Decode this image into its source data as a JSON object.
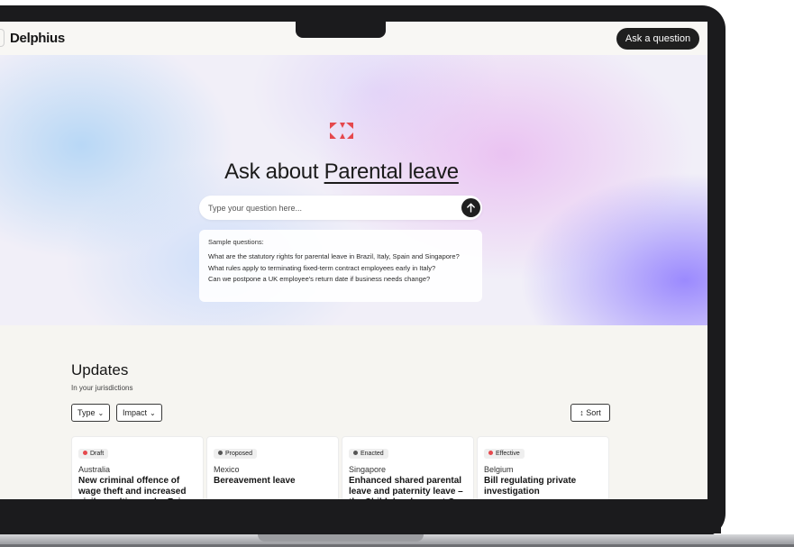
{
  "topbar": {
    "brand": "Delphius",
    "ask_button": "Ask a question"
  },
  "hero": {
    "title_prefix": "Ask about",
    "title_topic": "Parental leave",
    "search_placeholder": "Type your question here...",
    "samples_heading": "Sample questions:",
    "sample_questions": [
      "What are the statutory rights for parental leave in Brazil, Italy, Spain and Singapore?",
      "What rules apply to terminating fixed-term contract employees early in Italy?",
      "Can we postpone a UK employee's return date if business needs change?"
    ]
  },
  "updates": {
    "title": "Updates",
    "subtitle": "In your jurisdictions",
    "filters": [
      "Type",
      "Impact"
    ],
    "sort_label": "Sort",
    "cards": [
      {
        "status": "Draft",
        "status_color": "#e5484d",
        "country": "Australia",
        "title": "New criminal offence of wage theft and increased civil penalties under Fair"
      },
      {
        "status": "Proposed",
        "status_color": "#555555",
        "country": "Mexico",
        "title": "Bereavement leave"
      },
      {
        "status": "Enacted",
        "status_color": "#555555",
        "country": "Singapore",
        "title": "Enhanced shared parental leave and paternity leave – the Child development Co"
      },
      {
        "status": "Effective",
        "status_color": "#e5484d",
        "country": "Belgium",
        "title": "Bill regulating private investigation"
      }
    ]
  },
  "colors": {
    "accent": "#e5484d",
    "dark": "#1f1f1f"
  }
}
